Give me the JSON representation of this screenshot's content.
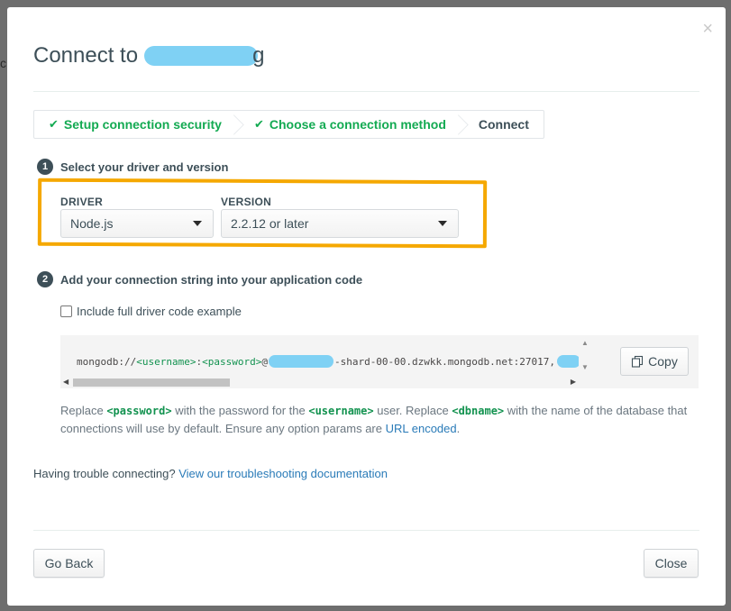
{
  "background": {
    "edge_fragment": "c"
  },
  "modal": {
    "close_glyph": "×",
    "title_prefix": "Connect to",
    "title_trailing_fragment": "g"
  },
  "wizard": {
    "steps": [
      {
        "label": "Setup connection security",
        "status": "complete"
      },
      {
        "label": "Choose a connection method",
        "status": "complete"
      },
      {
        "label": "Connect",
        "status": "current"
      }
    ]
  },
  "step1": {
    "number": "1",
    "heading": "Select your driver and version",
    "driver_label": "DRIVER",
    "driver_value": "Node.js",
    "version_label": "VERSION",
    "version_value": "2.2.12 or later"
  },
  "step2": {
    "number": "2",
    "heading": "Add your connection string into your application code",
    "checkbox_label": "Include full driver code example",
    "checkbox_checked": false,
    "code": {
      "prefix": "mongodb://",
      "username_token": "<username>",
      "colon": ":",
      "password_token": "<password>",
      "at": "@",
      "host_suffix": "-shard-00-00.dzwkk.mongodb.net:27017,"
    },
    "copy_label": "Copy"
  },
  "help_text": {
    "replace": "Replace",
    "password_token": "<password>",
    "with_password_for": "with the password for the",
    "username_token": "<username>",
    "user_replace": "user. Replace",
    "dbname_token": "<dbname>",
    "rest": "with the name of the database that connections will use by default. Ensure any option params are",
    "link": "URL encoded",
    "period": "."
  },
  "trouble": {
    "text": "Having trouble connecting?",
    "link": "View our troubleshooting documentation"
  },
  "footer": {
    "back_label": "Go Back",
    "close_label": "Close"
  },
  "colors": {
    "accent_green": "#13aa52",
    "highlight_orange": "#f5a800",
    "link_blue": "#2a7bb8",
    "redaction_blue": "#7fd1f4"
  }
}
